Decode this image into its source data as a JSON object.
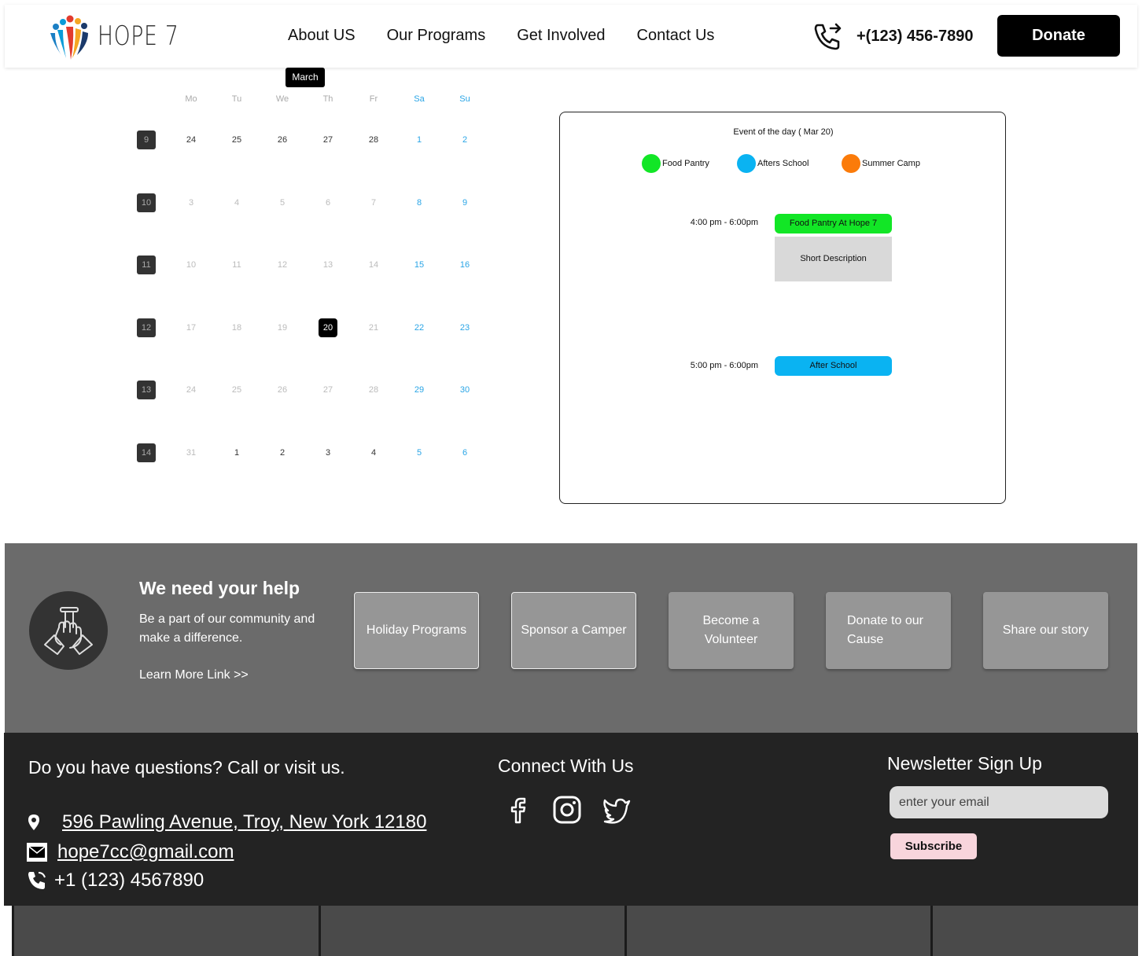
{
  "header": {
    "logo_text": "HOPE 7",
    "nav": [
      "About US",
      "Our Programs",
      "Get Involved",
      "Contact Us"
    ],
    "phone": "+(123) 456-7890",
    "donate_label": "Donate"
  },
  "calendar": {
    "month_label": "March",
    "weekdays": [
      "Mo",
      "Tu",
      "We",
      "Th",
      "Fr",
      "Sa",
      "Su"
    ],
    "weeks": [
      {
        "num": "9",
        "days": [
          "24",
          "25",
          "26",
          "27",
          "28",
          "1",
          "2"
        ]
      },
      {
        "num": "10",
        "days": [
          "3",
          "4",
          "5",
          "6",
          "7",
          "8",
          "9"
        ]
      },
      {
        "num": "11",
        "days": [
          "10",
          "11",
          "12",
          "13",
          "14",
          "15",
          "16"
        ]
      },
      {
        "num": "12",
        "days": [
          "17",
          "18",
          "19",
          "20",
          "21",
          "22",
          "23"
        ]
      },
      {
        "num": "13",
        "days": [
          "24",
          "25",
          "26",
          "27",
          "28",
          "29",
          "30"
        ]
      },
      {
        "num": "14",
        "days": [
          "31",
          "1",
          "2",
          "3",
          "4",
          "5",
          "6"
        ]
      }
    ],
    "selected_day": "20"
  },
  "event_panel": {
    "title": "Event of the day ( Mar 20)",
    "legend": [
      {
        "label": "Food Pantry",
        "color": "#12e626"
      },
      {
        "label": "Afters School",
        "color": "#0ab3f2"
      },
      {
        "label": "Summer Camp",
        "color": "#fb7b0a"
      }
    ],
    "events": [
      {
        "time": "4:00 pm - 6:00pm",
        "title": "Food Pantry At Hope 7",
        "color": "#12e626",
        "description": "Short Description"
      },
      {
        "time": "5:00 pm - 6:00pm",
        "title": "After School",
        "color": "#0ab3f2"
      }
    ]
  },
  "help": {
    "title": "We need your help",
    "subtitle": "Be a part of our community and make a difference.",
    "link": "Learn More Link >>",
    "cards": [
      "Holiday Programs",
      "Sponsor a Camper",
      "Become a Volunteer",
      "Donate to our Cause",
      "Share our story"
    ]
  },
  "footer": {
    "contact_heading": "Do you have questions? Call or visit us.",
    "address": "596 Pawling Avenue, Troy, New York 12180",
    "email": "hope7cc@gmail.com",
    "phone": "+1 (123) 4567890",
    "connect_heading": "Connect With Us",
    "social": [
      "facebook-icon",
      "instagram-icon",
      "twitter-icon"
    ],
    "newsletter_heading": "Newsletter Sign Up",
    "email_placeholder": "enter your email",
    "subscribe_label": "Subscribe"
  }
}
